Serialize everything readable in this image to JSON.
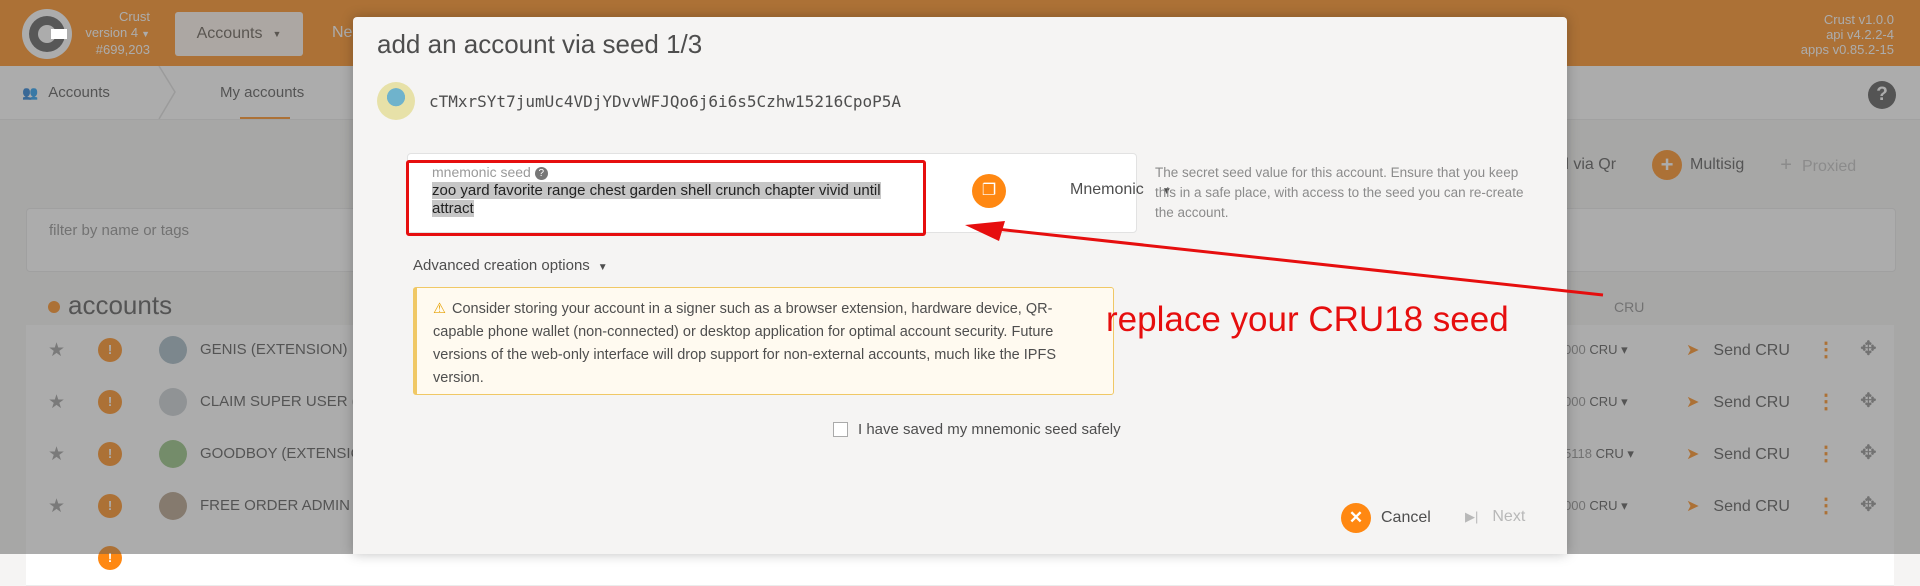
{
  "topbar": {
    "chain_name": "Crust",
    "chain_version": "version 4",
    "block": "#699,203",
    "nav_accounts": "Accounts",
    "nav_next_fragment": "Ne",
    "version_crust": "Crust v1.0.0",
    "version_api": "api v4.2.2-4",
    "version_apps": "apps v0.85.2-15"
  },
  "subnav": {
    "section": "Accounts",
    "current_tab": "My accounts"
  },
  "page": {
    "filter_placeholder": "filter by name or tags",
    "accounts_title": "accounts",
    "balance_header": "CRU",
    "actions": {
      "add_via_qr": "d via Qr",
      "multisig": "Multisig",
      "proxied": "Proxied"
    },
    "rows": [
      {
        "name": "GENIS (EXTENSION)",
        "balance_prefix": "000",
        "balance_unit": "CRU",
        "send": "Send CRU"
      },
      {
        "name": "CLAIM SUPER USER (E",
        "balance_prefix": "000",
        "balance_unit": "CRU",
        "send": "Send CRU"
      },
      {
        "name": "GOODBOY (EXTENSIO",
        "balance_prefix": "5118",
        "balance_unit": "CRU",
        "send": "Send CRU"
      },
      {
        "name": "FREE ORDER ADMIN (",
        "balance_prefix": "000",
        "balance_unit": "CRU",
        "send": "Send CRU"
      }
    ]
  },
  "modal": {
    "title": "add an account via seed 1/3",
    "address": "cTMxrSYt7jumUc4VDjYDvvWFJQo6j6i6s5Czhw15216CpoP5A",
    "seed_label": "mnemonic seed",
    "seed_value": "zoo yard favorite range chest garden shell crunch chapter vivid until attract",
    "seed_type": "Mnemonic",
    "seed_help": "The secret seed value for this account. Ensure that you keep this in a safe place, with access to the seed you can re-create the account.",
    "advanced_options": "Advanced creation options",
    "warning": "Consider storing your account in a signer such as a browser extension, hardware device, QR-capable phone wallet (non-connected) or desktop application for optimal account security. Future versions of the web-only interface will drop support for non-external accounts, much like the IPFS version.",
    "checkbox_label": "I have saved my mnemonic seed safely",
    "cancel": "Cancel",
    "next": "Next"
  },
  "annotation": {
    "text": "replace your CRU18 seed",
    "color": "#e60e0e"
  },
  "colors": {
    "brand": "#ff8812",
    "annotation_red": "#e60e0e"
  }
}
